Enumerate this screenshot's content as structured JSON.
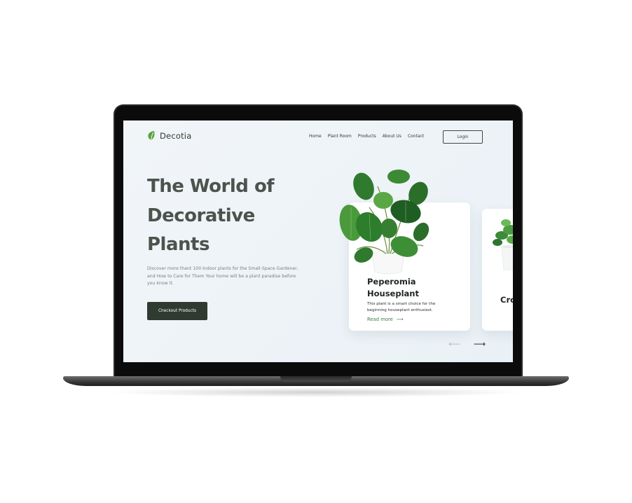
{
  "brand": {
    "name": "Decotia",
    "logo_icon": "leaf-icon",
    "accent": "#5aa343"
  },
  "nav": {
    "items": [
      "Home",
      "Plant Room",
      "Products",
      "About Us",
      "Contact"
    ],
    "login_label": "Login"
  },
  "hero": {
    "title_lines": [
      "The World of",
      "Decorative",
      "Plants"
    ],
    "description": "Discover more thant 100 Indoor plants for the Small-Space Gardener, and How to Care for Them Your home will be a plant paradise before you know it.",
    "cta_label": "Checkout Products"
  },
  "cards": [
    {
      "title": "Peperomia Houseplant",
      "description": "This plant is a smart choice for the beginning houseplant enthusiast.",
      "link_label": "Read more",
      "link_icon": "arrow-right-icon"
    },
    {
      "title": "Cro Hou"
    }
  ],
  "carousel": {
    "prev_icon": "arrow-left-icon",
    "next_icon": "arrow-right-icon",
    "prev_glyph": "⟵",
    "next_glyph": "⟶",
    "link_glyph": "⟶"
  },
  "colors": {
    "title": "#4c534d",
    "cta_bg": "#2f3a31",
    "link": "#3c7a4b",
    "screen_bg": "#eef3f7"
  }
}
